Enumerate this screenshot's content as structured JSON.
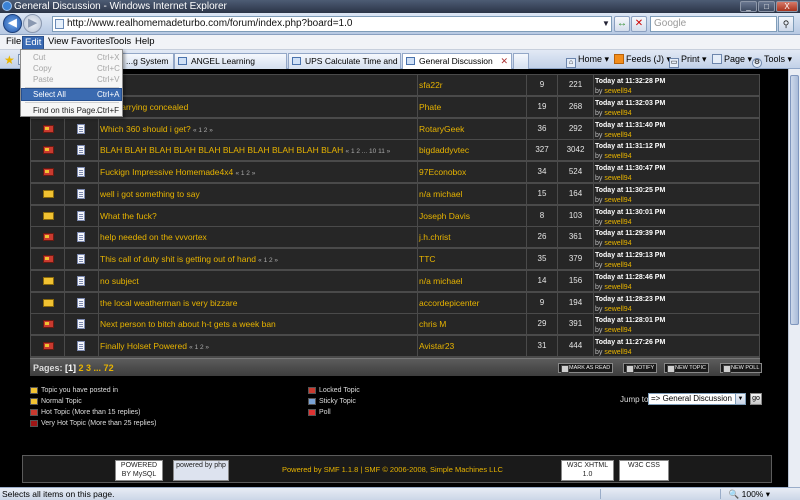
{
  "window": {
    "title": "General Discussion - Windows Internet Explorer",
    "buttons": [
      "_",
      "□",
      "X"
    ]
  },
  "address": {
    "url": "http://www.realhomemadeturbo.com/forum/index.php?board=1.0",
    "search_placeholder": "Google"
  },
  "menu": [
    "File",
    "Edit",
    "View",
    "Favorites",
    "Tools",
    "Help"
  ],
  "tabs": [
    {
      "label": "...g System"
    },
    {
      "label": "ANGEL Learning"
    },
    {
      "label": "UPS Calculate Time and Cost"
    },
    {
      "label": "General Discussion"
    }
  ],
  "toolbar": {
    "home": "Home",
    "feeds": "Feeds (J)",
    "print": "Print",
    "page": "Page",
    "tools": "Tools"
  },
  "edit_menu": [
    {
      "label": "Cut",
      "shortcut": "Ctrl+X",
      "disabled": true
    },
    {
      "label": "Copy",
      "shortcut": "Ctrl+C",
      "disabled": true
    },
    {
      "label": "Paste",
      "shortcut": "Ctrl+V",
      "disabled": true
    },
    {
      "label": "Select All",
      "shortcut": "Ctrl+A",
      "selected": true
    },
    {
      "label": "Find on this Page...",
      "shortcut": "Ctrl+F"
    }
  ],
  "topics": [
    {
      "subject": "...w",
      "pages": "",
      "starter": "sfa22r",
      "replies": "9",
      "views": "221",
      "time": "Today at 11:32:28 PM",
      "by": "sewell94",
      "hot": true
    },
    {
      "subject": "...or carrying concealed",
      "pages": "",
      "starter": "Phate",
      "replies": "19",
      "views": "268",
      "time": "Today at 11:32:03 PM",
      "by": "sewell94",
      "hot": true
    },
    {
      "subject": "Which 360 should i get?",
      "pages": "« 1 2 »",
      "starter": "RotaryGeek",
      "replies": "36",
      "views": "292",
      "time": "Today at 11:31:40 PM",
      "by": "sewell94",
      "hot": true
    },
    {
      "subject": "BLAH BLAH BLAH BLAH BLAH BLAH BLAH BLAH BLAH BLAH",
      "pages": "« 1 2 ... 10 11 »",
      "starter": "bigdaddyvtec",
      "replies": "327",
      "views": "3042",
      "time": "Today at 11:31:12 PM",
      "by": "sewell94",
      "hot": true
    },
    {
      "subject": "Fuckign Impressive Homemade4x4",
      "pages": "« 1 2 »",
      "starter": "97Econobox",
      "replies": "34",
      "views": "524",
      "time": "Today at 11:30:47 PM",
      "by": "sewell94",
      "hot": true
    },
    {
      "subject": "well i got something to say",
      "pages": "",
      "starter": "n/a michael",
      "replies": "15",
      "views": "164",
      "time": "Today at 11:30:25 PM",
      "by": "sewell94",
      "hot": false
    },
    {
      "subject": "What the fuck?",
      "pages": "",
      "starter": "Joseph Davis",
      "replies": "8",
      "views": "103",
      "time": "Today at 11:30:01 PM",
      "by": "sewell94",
      "hot": false
    },
    {
      "subject": "help needed on the vvvortex",
      "pages": "",
      "starter": "j.h.christ",
      "replies": "26",
      "views": "361",
      "time": "Today at 11:29:39 PM",
      "by": "sewell94",
      "hot": true
    },
    {
      "subject": "This call of duty shit is getting out of hand",
      "pages": "« 1 2 »",
      "starter": "TTC",
      "replies": "35",
      "views": "379",
      "time": "Today at 11:29:13 PM",
      "by": "sewell94",
      "hot": true
    },
    {
      "subject": "no subject",
      "pages": "",
      "starter": "n/a michael",
      "replies": "14",
      "views": "156",
      "time": "Today at 11:28:46 PM",
      "by": "sewell94",
      "hot": false
    },
    {
      "subject": "the local weatherman is very bizzare",
      "pages": "",
      "starter": "accordepicenter",
      "replies": "9",
      "views": "194",
      "time": "Today at 11:28:23 PM",
      "by": "sewell94",
      "hot": false
    },
    {
      "subject": "Next person to bitch about h-t gets a week ban",
      "pages": "",
      "starter": "chris M",
      "replies": "29",
      "views": "391",
      "time": "Today at 11:28:01 PM",
      "by": "sewell94",
      "hot": true
    },
    {
      "subject": "Finally Holset Powered",
      "pages": "« 1 2 »",
      "starter": "Avistar23",
      "replies": "31",
      "views": "444",
      "time": "Today at 11:27:26 PM",
      "by": "sewell94",
      "hot": true
    }
  ],
  "pages_bar": {
    "label": "Pages:",
    "current": "[1]",
    "links": "2 3 ... 72"
  },
  "actions": [
    "MARK AS READ",
    "NOTIFY",
    "NEW TOPIC",
    "NEW POLL"
  ],
  "legend": {
    "left": [
      "Topic you have posted in",
      "Normal Topic",
      "Hot Topic (More than 15 replies)",
      "Very Hot Topic (More than 25 replies)"
    ],
    "right": [
      "Locked Topic",
      "Sticky Topic",
      "Poll"
    ]
  },
  "jump": {
    "label": "Jump to:",
    "value": "=> General Discussion",
    "go": "go"
  },
  "footer": {
    "text": "Powered by SMF 1.1.8 | SMF © 2006-2008, Simple Machines LLC",
    "badges": [
      "POWERED BY MySQL",
      "powered by php",
      "W3C XHTML 1.0",
      "W3C CSS"
    ]
  },
  "status": {
    "text": "Selects all items on this page.",
    "zoom": "100%"
  },
  "colors": {
    "accent": "#e8b400",
    "row_bg": "#262626",
    "selection": "#3a6ab0"
  }
}
